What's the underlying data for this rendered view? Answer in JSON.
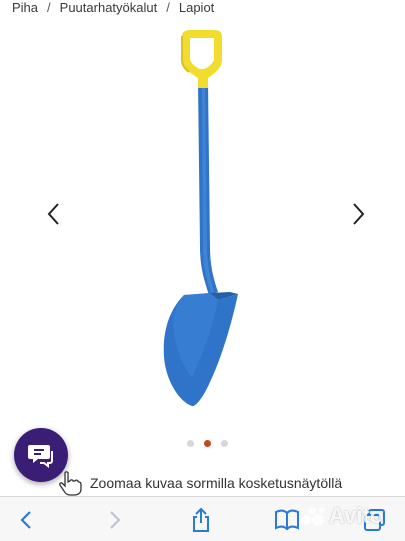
{
  "breadcrumb": {
    "items": [
      "Piha",
      "Puutarhatyökalut",
      "Lapiot"
    ],
    "separator": "/"
  },
  "gallery": {
    "image_subject": "shovel",
    "dot_count": 3,
    "active_index": 1,
    "colors": {
      "blade": "#2f74c8",
      "handle": "#f2dc2e",
      "active_dot": "#c8461f"
    }
  },
  "zoom_hint": {
    "text": "Zoomaa kuvaa sormilla kosketusnäytöllä",
    "icon": "hand-pointer-icon"
  },
  "chat": {
    "icon": "chat-bubbles-icon",
    "color": "#3a1d75"
  },
  "toolbar": {
    "icons": [
      "back-icon",
      "forward-icon",
      "share-icon",
      "bookmarks-icon",
      "tabs-icon"
    ]
  },
  "watermark": {
    "text": "Avito"
  }
}
